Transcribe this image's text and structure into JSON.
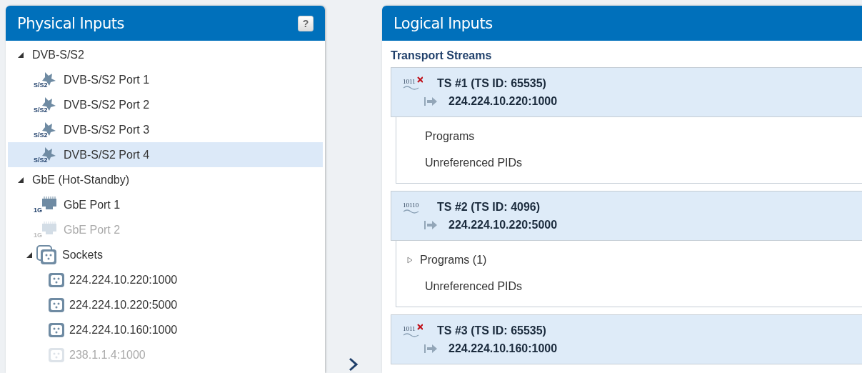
{
  "physical_inputs": {
    "title": "Physical Inputs",
    "help_label": "?",
    "tree": [
      {
        "label": "DVB-S/S2",
        "expanded": true,
        "children": [
          {
            "label": "DVB-S/S2 Port 1",
            "kind": "satellite",
            "icon_text": "S/S2",
            "selected": false,
            "disabled": false
          },
          {
            "label": "DVB-S/S2 Port 2",
            "kind": "satellite",
            "icon_text": "S/S2",
            "selected": false,
            "disabled": false
          },
          {
            "label": "DVB-S/S2 Port 3",
            "kind": "satellite",
            "icon_text": "S/S2",
            "selected": false,
            "disabled": false
          },
          {
            "label": "DVB-S/S2 Port 4",
            "kind": "satellite",
            "icon_text": "S/S2",
            "selected": true,
            "disabled": false
          }
        ]
      },
      {
        "label": "GbE (Hot-Standby)",
        "expanded": true,
        "children": [
          {
            "label": "GbE Port 1",
            "kind": "ethernet",
            "icon_text": "1G",
            "selected": false,
            "disabled": false
          },
          {
            "label": "GbE Port 2",
            "kind": "ethernet",
            "icon_text": "1G",
            "selected": false,
            "disabled": true
          },
          {
            "label": "Sockets",
            "kind": "sockets",
            "expanded": true,
            "selected": false,
            "disabled": false,
            "children": [
              {
                "label": "224.224.10.220:1000",
                "kind": "socket",
                "selected": false,
                "disabled": false
              },
              {
                "label": "224.224.10.220:5000",
                "kind": "socket",
                "selected": false,
                "disabled": false
              },
              {
                "label": "224.224.10.160:1000",
                "kind": "socket",
                "selected": false,
                "disabled": false
              },
              {
                "label": "238.1.1.4:1000",
                "kind": "socket",
                "selected": false,
                "disabled": true
              }
            ]
          }
        ]
      }
    ]
  },
  "logical_inputs": {
    "title": "Logical Inputs",
    "section": "Transport Streams",
    "streams": [
      {
        "icon_text": "1011",
        "error": true,
        "name": "TS #1 (TS ID: 65535)",
        "address": "224.224.10.220:1000",
        "items": [
          {
            "label": "Programs",
            "kind": "leaf"
          },
          {
            "label": "Unreferenced PIDs",
            "kind": "leaf"
          }
        ]
      },
      {
        "icon_text": "10110",
        "error": false,
        "name": "TS #2 (TS ID: 4096)",
        "address": "224.224.10.220:5000",
        "items": [
          {
            "label": "Programs (1)",
            "kind": "collapsed"
          },
          {
            "label": "Unreferenced PIDs",
            "kind": "leaf"
          }
        ]
      },
      {
        "icon_text": "1011",
        "error": true,
        "name": "TS #3 (TS ID: 65535)",
        "address": "224.224.10.160:1000"
      }
    ]
  }
}
